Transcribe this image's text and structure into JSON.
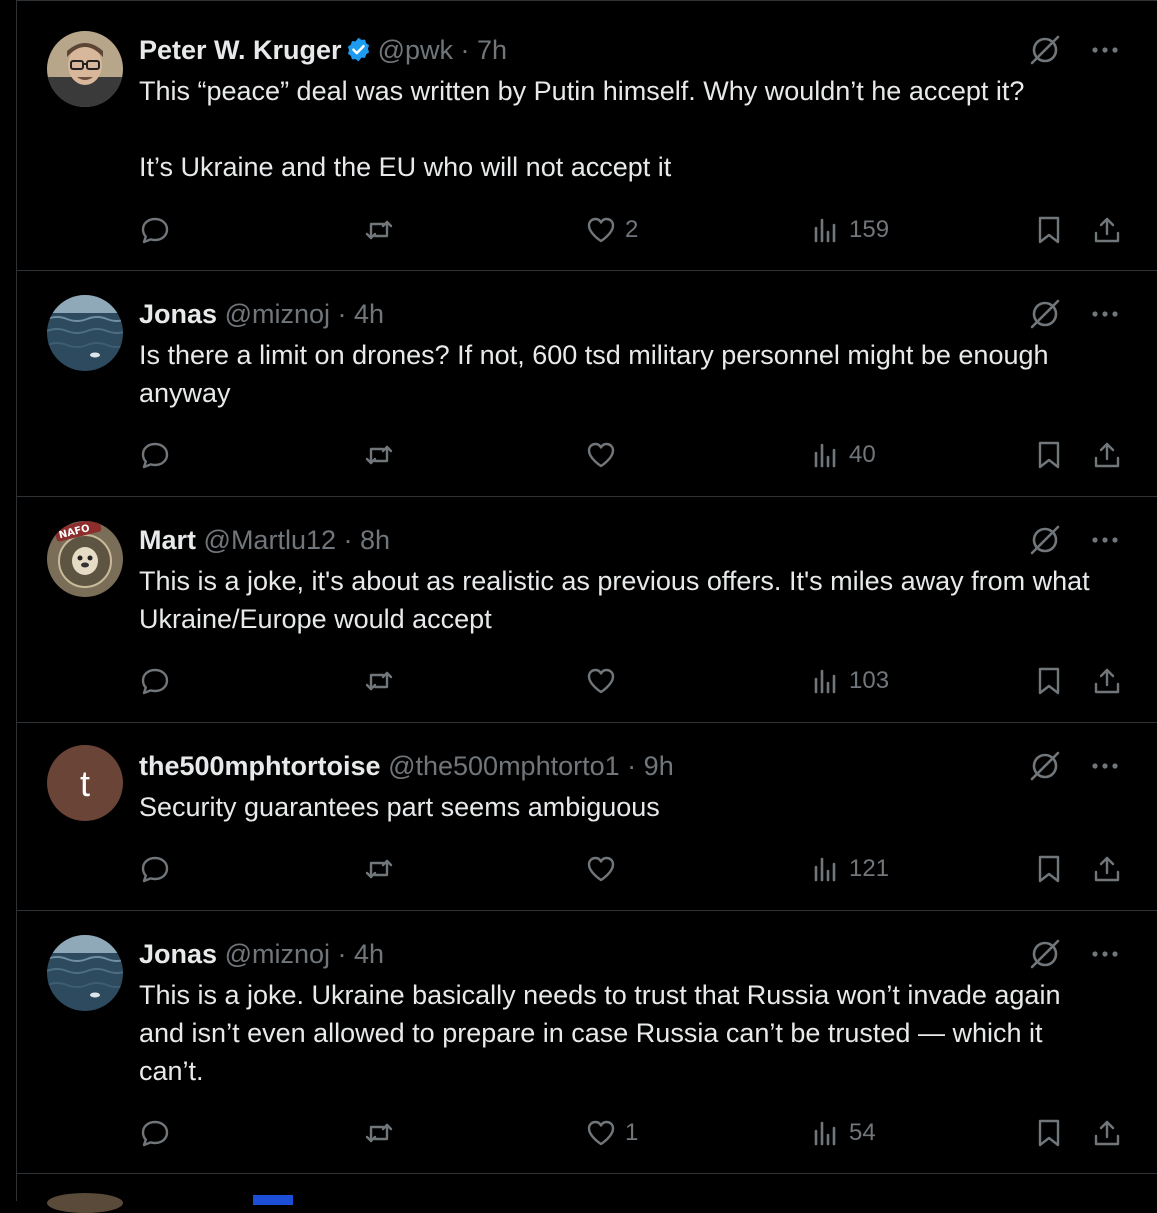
{
  "tweets": [
    {
      "name": "Peter W. Kruger",
      "verified": true,
      "handle": "@pwk",
      "time": "7h",
      "text": "This “peace” deal was written by Putin himself. Why wouldn’t he accept it?\n\nIt’s Ukraine and the EU who will not accept it",
      "likes": "2",
      "views": "159",
      "avatar": "photo-man-glasses"
    },
    {
      "name": "Jonas",
      "verified": false,
      "handle": "@miznoj",
      "time": "4h",
      "text": "Is there a limit on drones? If not, 600 tsd military personnel might be enough anyway",
      "likes": "",
      "views": "40",
      "avatar": "photo-sea"
    },
    {
      "name": "Mart",
      "verified": false,
      "handle": "@Martlu12",
      "time": "8h",
      "text": "This is a joke, it's about as realistic as previous offers. It's miles away from what Ukraine/Europe would accept",
      "likes": "",
      "views": "103",
      "avatar": "nafo-badge",
      "avatar_text": "NAFO"
    },
    {
      "name": "the500mphtortoise",
      "verified": false,
      "handle": "@the500mphtorto1",
      "time": "9h",
      "text": "Security guarantees part seems ambiguous",
      "likes": "",
      "views": "121",
      "avatar": "letter-avatar",
      "avatar_letter": "t"
    },
    {
      "name": "Jonas",
      "verified": false,
      "handle": "@miznoj",
      "time": "4h",
      "text": "This is a joke. Ukraine basically needs to trust that Russia won’t invade again and isn’t even allowed to prepare in case Russia can’t be trusted — which it can’t.",
      "likes": "1",
      "views": "54",
      "avatar": "photo-sea"
    }
  ],
  "separator": "·",
  "colors": {
    "background": "#000000",
    "text": "#e7e9ea",
    "muted": "#71767b",
    "border": "#2f3336",
    "verified": "#1d9bf0"
  },
  "icons": [
    "reply-icon",
    "retweet-icon",
    "like-icon",
    "views-icon",
    "bookmark-icon",
    "share-icon",
    "grok-icon",
    "more-icon",
    "verified-badge-icon"
  ]
}
